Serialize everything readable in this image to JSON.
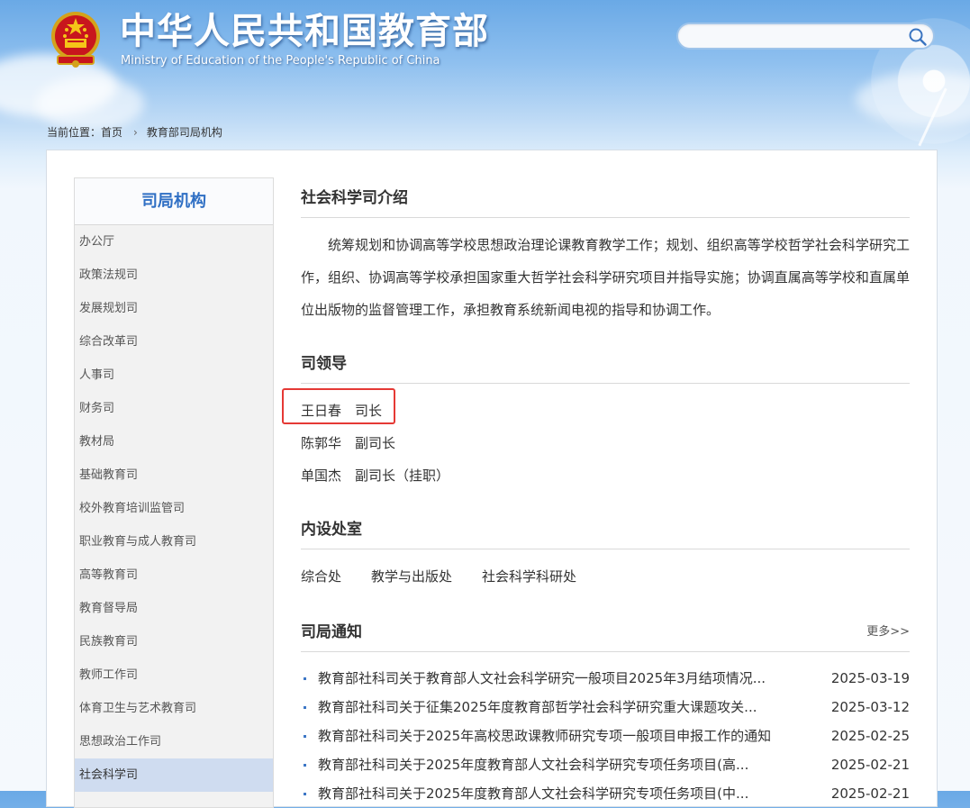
{
  "header": {
    "title": "中华人民共和国教育部",
    "subtitle": "Ministry of Education of the People's Republic of China",
    "search_placeholder": ""
  },
  "breadcrumb": {
    "prefix": "当前位置：",
    "home": "首页",
    "current": "教育部司局机构"
  },
  "sidebar": {
    "heading": "司局机构",
    "items": [
      "办公厅",
      "政策法规司",
      "发展规划司",
      "综合改革司",
      "人事司",
      "财务司",
      "教材局",
      "基础教育司",
      "校外教育培训监管司",
      "职业教育与成人教育司",
      "高等教育司",
      "教育督导局",
      "民族教育司",
      "教师工作司",
      "体育卫生与艺术教育司",
      "思想政治工作司",
      "社会科学司"
    ],
    "active_index": 16
  },
  "intro": {
    "heading": "社会科学司介绍",
    "text": "统筹规划和协调高等学校思想政治理论课教育教学工作；规划、组织高等学校哲学社会科学研究工作，组织、协调高等学校承担国家重大哲学社会科学研究项目并指导实施；协调直属高等学校和直属单位出版物的监督管理工作，承担教育系统新闻电视的指导和协调工作。"
  },
  "leaders": {
    "heading": "司领导",
    "items": [
      {
        "name": "王日春",
        "title": "司长"
      },
      {
        "name": "陈郭华",
        "title": "副司长"
      },
      {
        "name": "单国杰",
        "title": "副司长（挂职）"
      }
    ]
  },
  "divisions": {
    "heading": "内设处室",
    "items": [
      "综合处",
      "教学与出版处",
      "社会科学科研处"
    ]
  },
  "notices": {
    "heading": "司局通知",
    "more": "更多>>",
    "items": [
      {
        "title": "教育部社科司关于教育部人文社会科学研究一般项目2025年3月结项情况...",
        "date": "2025-03-19"
      },
      {
        "title": "教育部社科司关于征集2025年度教育部哲学社会科学研究重大课题攻关...",
        "date": "2025-03-12"
      },
      {
        "title": "教育部社科司关于2025年高校思政课教师研究专项一般项目申报工作的通知",
        "date": "2025-02-25"
      },
      {
        "title": "教育部社科司关于2025年度教育部人文社会科学研究专项任务项目(高...",
        "date": "2025-02-21"
      },
      {
        "title": "教育部社科司关于2025年度教育部人文社会科学研究专项任务项目(中...",
        "date": "2025-02-21"
      }
    ]
  },
  "colors": {
    "accent": "#2f6fc4",
    "highlight_box": "#e53935",
    "sidebar_active": "#cfdcf0"
  }
}
